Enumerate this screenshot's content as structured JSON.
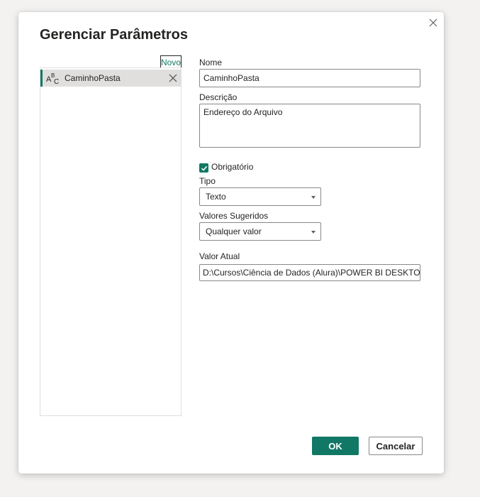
{
  "dialog": {
    "title": "Gerenciar Parâmetros",
    "close_icon": "close-icon",
    "new_label": "Novo"
  },
  "parameters": [
    {
      "name": "CaminhoPasta",
      "type_icon": "abc-text-type-icon",
      "delete_icon": "close-icon",
      "selected": true
    }
  ],
  "form": {
    "name_label": "Nome",
    "name_value": "CaminhoPasta",
    "description_label": "Descrição",
    "description_value": "Endereço do Arquivo",
    "required_label": "Obrigatório",
    "required_checked": true,
    "type_label": "Tipo",
    "type_value": "Texto",
    "suggested_label": "Valores Sugeridos",
    "suggested_value": "Qualquer valor",
    "current_label": "Valor Atual",
    "current_value": "D:\\Cursos\\Ciência de Dados (Alura)\\POWER BI DESKTOP R"
  },
  "footer": {
    "ok_label": "OK",
    "cancel_label": "Cancelar"
  },
  "colors": {
    "accent": "#117865",
    "selection": "#e1dfdd",
    "border": "#8a8886"
  }
}
